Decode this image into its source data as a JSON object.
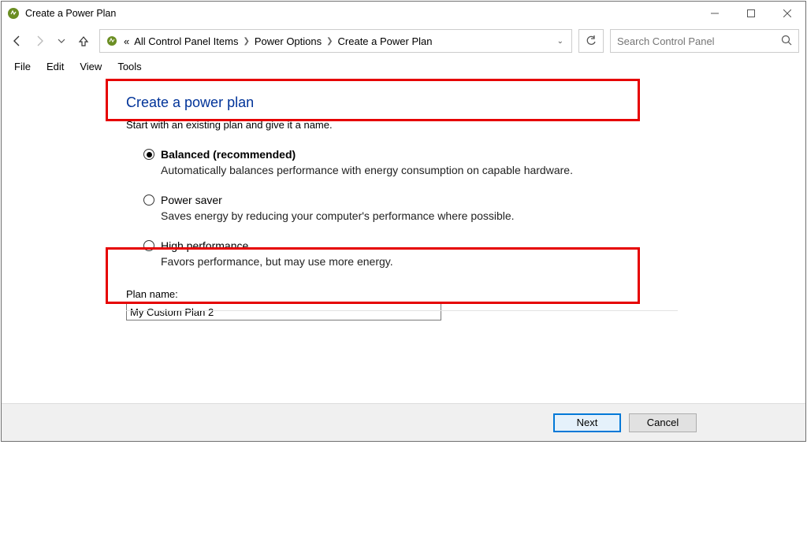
{
  "titlebar": {
    "title": "Create a Power Plan"
  },
  "breadcrumb": {
    "items": [
      "All Control Panel Items",
      "Power Options",
      "Create a Power Plan"
    ],
    "prefix": "«"
  },
  "search": {
    "placeholder": "Search Control Panel"
  },
  "menu": {
    "file": "File",
    "edit": "Edit",
    "view": "View",
    "tools": "Tools"
  },
  "page": {
    "heading": "Create a power plan",
    "subheading": "Start with an existing plan and give it a name."
  },
  "plans": [
    {
      "name": "Balanced (recommended)",
      "desc": "Automatically balances performance with energy consumption on capable hardware.",
      "selected": true,
      "bold": true
    },
    {
      "name": "Power saver",
      "desc": "Saves energy by reducing your computer's performance where possible.",
      "selected": false,
      "bold": false
    },
    {
      "name": "High performance",
      "desc": "Favors performance, but may use more energy.",
      "selected": false,
      "bold": false
    }
  ],
  "plan_name": {
    "label": "Plan name:",
    "value": "My Custom Plan 2"
  },
  "buttons": {
    "next": "Next",
    "cancel": "Cancel"
  }
}
